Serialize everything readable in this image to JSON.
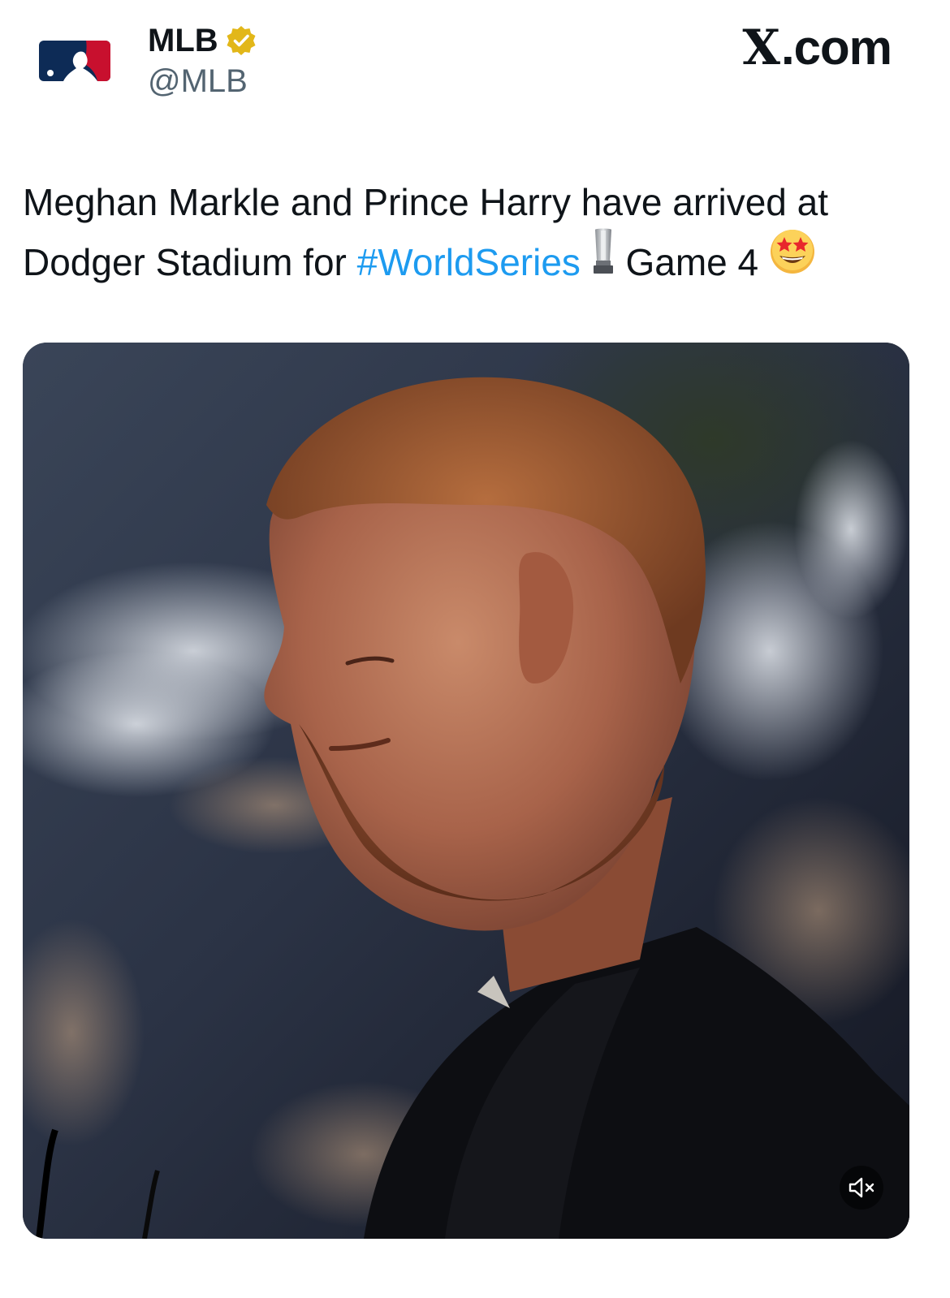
{
  "author": {
    "display_name": "MLB",
    "handle": "@MLB",
    "verified": true,
    "logo_name": "mlb-logo"
  },
  "brand": {
    "dot_com": ".com",
    "x_letter": "X"
  },
  "tweet": {
    "text_part1": "Meghan Markle and Prince Harry have arrived at Dodger Stadium for ",
    "hashtag": "#WorldSeries",
    "text_part2": " Game 4 ",
    "emojis": [
      "trophy-icon",
      "star-struck-emoji"
    ]
  },
  "media": {
    "type": "video",
    "muted": true
  },
  "colors": {
    "hashtag": "#1d9bf0",
    "handle": "#536471",
    "verified_badge": "#e2b719",
    "mlb_blue": "#0d2b56",
    "mlb_red": "#c8102e"
  }
}
